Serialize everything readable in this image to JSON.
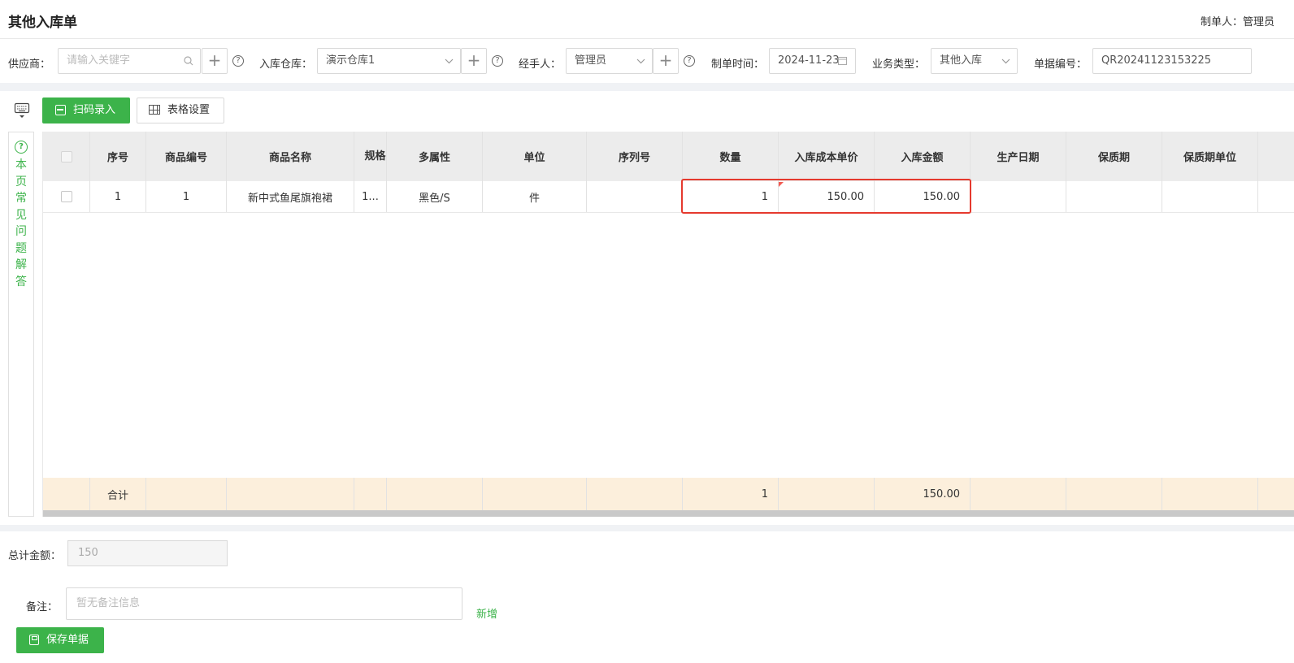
{
  "header": {
    "title": "其他入库单",
    "creator_label": "制单人：",
    "creator_value": "管理员"
  },
  "form": {
    "supplier": {
      "label": "供应商：",
      "placeholder": "请输入关键字"
    },
    "warehouse": {
      "label": "入库仓库：",
      "value": "演示仓库1"
    },
    "handler": {
      "label": "经手人：",
      "value": "管理员"
    },
    "date": {
      "label": "制单时间：",
      "value": "2024-11-23"
    },
    "biz_type": {
      "label": "业务类型：",
      "value": "其他入库"
    },
    "doc_no": {
      "label": "单据编号：",
      "value": "QR20241123153225"
    }
  },
  "toolbar": {
    "scan_label": "扫码录入",
    "table_settings_label": "表格设置"
  },
  "faq": {
    "text": "本页常见问题解答"
  },
  "table": {
    "columns": [
      "序号",
      "商品编号",
      "商品名称",
      "规格",
      "多属性",
      "单位",
      "序列号",
      "数量",
      "入库成本单价",
      "入库金额",
      "生产日期",
      "保质期",
      "保质期单位"
    ],
    "rows": [
      {
        "seq": "1",
        "code": "1",
        "name": "新中式鱼尾旗袍裙",
        "spec": "1...",
        "attr": "黑色/S",
        "unit": "件",
        "serial": "",
        "qty": "1",
        "unit_cost": "150.00",
        "amount": "150.00",
        "prod_date": "",
        "shelf_life": "",
        "shelf_unit": ""
      }
    ],
    "summary": {
      "label": "合计",
      "qty": "1",
      "amount": "150.00"
    }
  },
  "footer": {
    "total_label": "总计金额：",
    "total_value": "150",
    "remark_label": "备注：",
    "remark_placeholder": "暂无备注信息",
    "add_link": "新增",
    "save_label": "保存单据"
  },
  "colors": {
    "accent": "#3cb34a",
    "highlight_border": "#e53a2e",
    "summary_bg": "#fcefdc",
    "header_bg": "#ececec"
  }
}
